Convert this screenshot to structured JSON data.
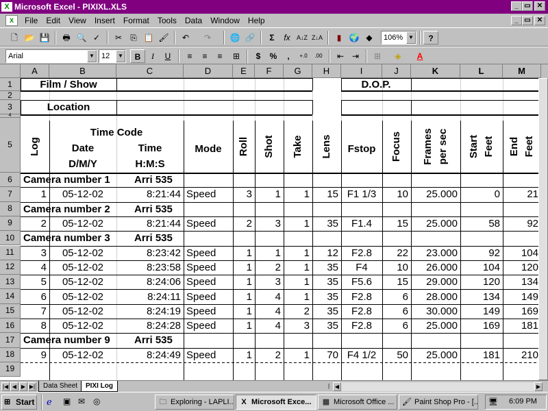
{
  "window": {
    "title": "Microsoft Excel - PIXIXL.XLS"
  },
  "menu": [
    "File",
    "Edit",
    "View",
    "Insert",
    "Format",
    "Tools",
    "Data",
    "Window",
    "Help"
  ],
  "toolbar": {
    "font": "Arial",
    "size": "12",
    "zoom": "106%"
  },
  "columns": [
    "A",
    "B",
    "C",
    "D",
    "E",
    "F",
    "G",
    "H",
    "I",
    "J",
    "K",
    "L",
    "M"
  ],
  "header": {
    "film_label": "Film / Show",
    "dop_label": "D.O.P.",
    "location_label": "Location",
    "log": "Log",
    "timecode": "Time Code",
    "date": "Date",
    "date_fmt": "D/M/Y",
    "time": "Time",
    "time_fmt": "H:M:S",
    "mode": "Mode",
    "roll": "Roll",
    "shot": "Shot",
    "take": "Take",
    "lens": "Lens",
    "fstop": "Fstop",
    "focus": "Focus",
    "frames1": "Frames",
    "frames2": "per sec",
    "start1": "Start",
    "start2": "Feet",
    "end1": "End",
    "end2": "Feet"
  },
  "rows": [
    {
      "num": "6",
      "type": "camera",
      "camera": "Camera number 1",
      "model": "Arri  535"
    },
    {
      "num": "7",
      "type": "data",
      "log": "1",
      "date": "05-12-02",
      "time": "8:21:44",
      "mode": "Speed",
      "roll": "3",
      "shot": "1",
      "take": "1",
      "lens": "15",
      "fstop": "F1 1/3",
      "focus": "10",
      "fps": "25.000",
      "start": "0",
      "end": "21"
    },
    {
      "num": "8",
      "type": "camera",
      "camera": "Camera number 2",
      "model": "Arri  535"
    },
    {
      "num": "9",
      "type": "data",
      "log": "2",
      "date": "05-12-02",
      "time": "8:21:44",
      "mode": "Speed",
      "roll": "2",
      "shot": "3",
      "take": "1",
      "lens": "35",
      "fstop": "F1.4",
      "focus": "15",
      "fps": "25.000",
      "start": "58",
      "end": "92"
    },
    {
      "num": "10",
      "type": "camera",
      "camera": "Camera number 3",
      "model": "Arri  535"
    },
    {
      "num": "11",
      "type": "data",
      "log": "3",
      "date": "05-12-02",
      "time": "8:23:42",
      "mode": "Speed",
      "roll": "1",
      "shot": "1",
      "take": "1",
      "lens": "12",
      "fstop": "F2.8",
      "focus": "22",
      "fps": "23.000",
      "start": "92",
      "end": "104"
    },
    {
      "num": "12",
      "type": "data",
      "log": "4",
      "date": "05-12-02",
      "time": "8:23:58",
      "mode": "Speed",
      "roll": "1",
      "shot": "2",
      "take": "1",
      "lens": "35",
      "fstop": "F4",
      "focus": "10",
      "fps": "26.000",
      "start": "104",
      "end": "120"
    },
    {
      "num": "13",
      "type": "data",
      "log": "5",
      "date": "05-12-02",
      "time": "8:24:06",
      "mode": "Speed",
      "roll": "1",
      "shot": "3",
      "take": "1",
      "lens": "35",
      "fstop": "F5.6",
      "focus": "15",
      "fps": "29.000",
      "start": "120",
      "end": "134"
    },
    {
      "num": "14",
      "type": "data",
      "log": "6",
      "date": "05-12-02",
      "time": "8:24:11",
      "mode": "Speed",
      "roll": "1",
      "shot": "4",
      "take": "1",
      "lens": "35",
      "fstop": "F2.8",
      "focus": "6",
      "fps": "28.000",
      "start": "134",
      "end": "149"
    },
    {
      "num": "15",
      "type": "data",
      "log": "7",
      "date": "05-12-02",
      "time": "8:24:19",
      "mode": "Speed",
      "roll": "1",
      "shot": "4",
      "take": "2",
      "lens": "35",
      "fstop": "F2.8",
      "focus": "6",
      "fps": "30.000",
      "start": "149",
      "end": "169"
    },
    {
      "num": "16",
      "type": "data",
      "log": "8",
      "date": "05-12-02",
      "time": "8:24:28",
      "mode": "Speed",
      "roll": "1",
      "shot": "4",
      "take": "3",
      "lens": "35",
      "fstop": "F2.8",
      "focus": "6",
      "fps": "25.000",
      "start": "169",
      "end": "181"
    },
    {
      "num": "17",
      "type": "camera",
      "camera": "Camera number 9",
      "model": "Arri  535"
    },
    {
      "num": "18",
      "type": "data",
      "log": "9",
      "date": "05-12-02",
      "time": "8:24:49",
      "mode": "Speed",
      "roll": "1",
      "shot": "2",
      "take": "1",
      "lens": "70",
      "fstop": "F4  1/2",
      "focus": "50",
      "fps": "25.000",
      "start": "181",
      "end": "210"
    },
    {
      "num": "19",
      "type": "empty"
    }
  ],
  "sheets": [
    "Data Sheet",
    "PIXI Log"
  ],
  "taskbar": {
    "start": "Start",
    "tasks": [
      "Exploring - LAPLI...",
      "Microsoft Exce...",
      "Microsoft Office ...",
      "Paint Shop Pro - [..."
    ],
    "clock": "6:09 PM"
  },
  "colors": {
    "titlebar": "#800080",
    "face": "#c0c0c0"
  }
}
